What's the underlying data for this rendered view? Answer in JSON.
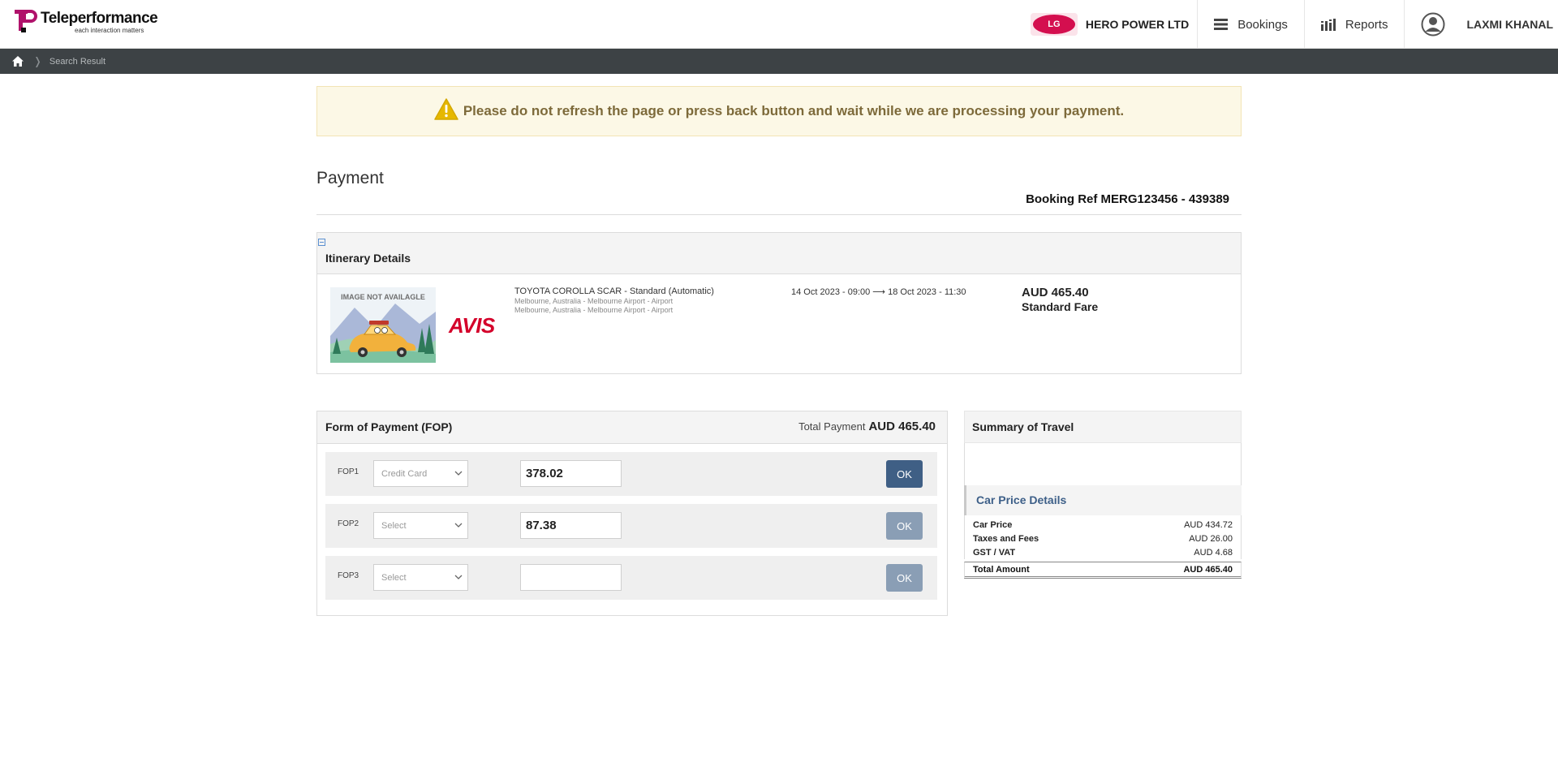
{
  "header": {
    "logo_name": "Teleperformance",
    "logo_tagline": "each interaction matters",
    "company_logo_text": "LG",
    "company_name": "HERO POWER LTD",
    "nav_bookings": "Bookings",
    "nav_reports": "Reports",
    "user_name": "LAXMI KHANAL"
  },
  "breadcrumb": {
    "current": "Search Result"
  },
  "alert": {
    "message": "Please do not refresh the page or press back button and wait while we are processing your payment."
  },
  "page": {
    "title": "Payment",
    "booking_ref": "Booking Ref MERG123456 - 439389"
  },
  "itinerary": {
    "title": "Itinerary Details",
    "image_placeholder": "IMAGE NOT AVAILAGLE",
    "vendor": "AVIS",
    "car_name": "TOYOTA COROLLA SCAR - Standard (Automatic)",
    "pickup_location": "Melbourne, Australia - Melbourne Airport - Airport",
    "dropoff_location": "Melbourne, Australia - Melbourne Airport - Airport",
    "dates": "14 Oct 2023 - 09:00 ⟶ 18 Oct 2023 - 11:30",
    "price": "AUD 465.40",
    "fare_type": "Standard Fare"
  },
  "fop": {
    "title": "Form of Payment (FOP)",
    "total_label": "Total Payment",
    "total_value": "AUD 465.40",
    "rows": [
      {
        "label": "FOP1",
        "method": "Credit Card",
        "amount": "378.02",
        "ok": "OK"
      },
      {
        "label": "FOP2",
        "method": "Select",
        "amount": "87.38",
        "ok": "OK"
      },
      {
        "label": "FOP3",
        "method": "Select",
        "amount": "",
        "ok": "OK"
      }
    ]
  },
  "summary": {
    "title": "Summary of Travel",
    "section_title": "Car Price Details",
    "rows": [
      {
        "label": "Car Price",
        "value": "AUD 434.72"
      },
      {
        "label": "Taxes and Fees",
        "value": "AUD 26.00"
      },
      {
        "label": "GST / VAT",
        "value": "AUD 4.68"
      }
    ],
    "total_label": "Total Amount",
    "total_value": "AUD 465.40"
  },
  "colors": {
    "ok_active": "#3f5f85",
    "ok_inactive": "#8a9eb5",
    "alert_bg": "#fcf8e6",
    "breadcrumb_bg": "#3d4245",
    "brand_magenta": "#b0126b"
  }
}
